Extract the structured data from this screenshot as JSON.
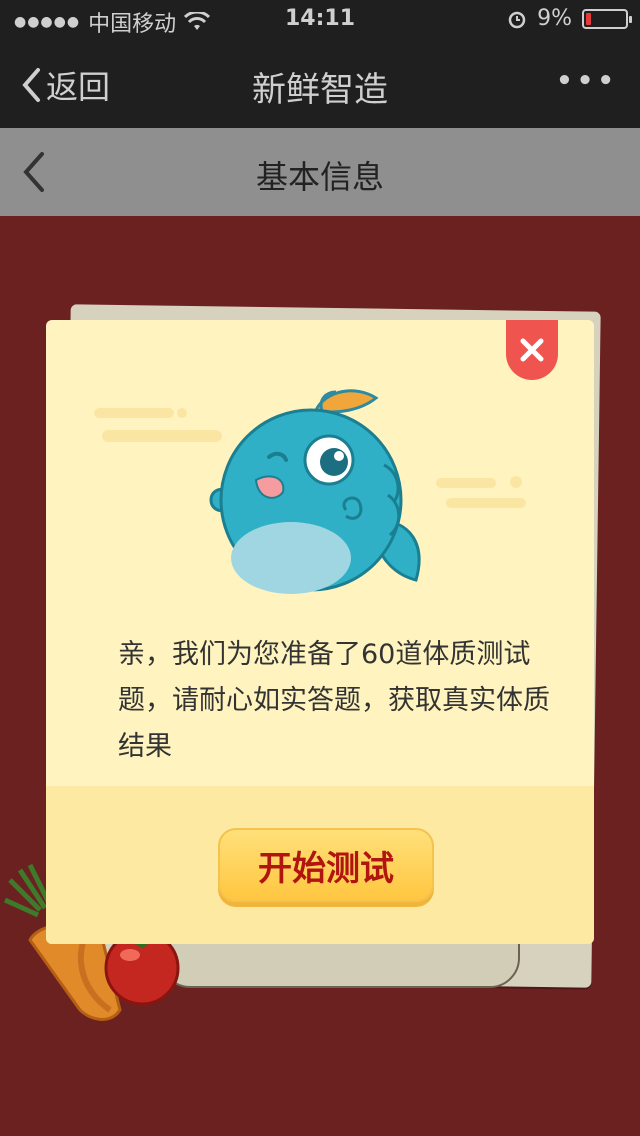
{
  "status_bar": {
    "signal_dots": "●●●●●",
    "carrier": "中国移动",
    "time": "14:11",
    "battery_percent": "9%",
    "battery_level": 0.09
  },
  "nav": {
    "back_label": "返回",
    "title": "新鲜智造",
    "more_label": "•••"
  },
  "page_header": {
    "title": "基本信息"
  },
  "modal": {
    "message": "亲，我们为您准备了60道体质测试题，请耐心如实答题，获取真实体质结果",
    "start_button": "开始测试"
  },
  "icons": {
    "wifi": "wifi-icon",
    "alarm": "alarm-icon",
    "back": "chevron-left-icon",
    "close": "close-icon",
    "mascot": "fish-mascot-icon",
    "veggies": "vegetables-illustration"
  },
  "colors": {
    "background": "#6a2120",
    "modal": "#fff4bf",
    "button_text": "#b0150f",
    "close_button": "#f0544f"
  }
}
